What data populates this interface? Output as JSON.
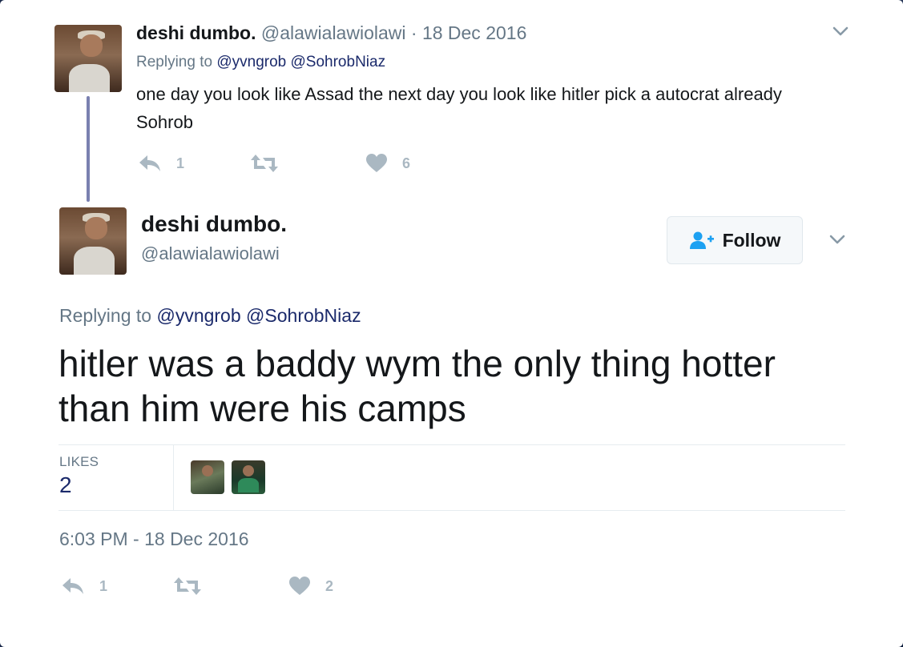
{
  "parent_tweet": {
    "name": "deshi dumbo.",
    "handle": "@alawialawiolawi",
    "separator": "·",
    "date": "18 Dec 2016",
    "replying_prefix": "Replying to",
    "mention1": "@yvngrob",
    "mention2": "@SohrobNiaz",
    "text": "one day you look like Assad the next day you look like hitler pick a autocrat already Sohrob",
    "reply_count": "1",
    "retweet_count": "",
    "like_count": "6"
  },
  "main_tweet": {
    "name": "deshi dumbo.",
    "handle": "@alawialawiolawi",
    "follow_label": "Follow",
    "replying_prefix": "Replying to",
    "mention1": "@yvngrob",
    "mention2": "@SohrobNiaz",
    "text": "hitler was a baddy wym the only thing hotter than him were his camps",
    "likes_label": "LIKES",
    "likes_count": "2",
    "timestamp": "6:03 PM - 18 Dec 2016",
    "reply_count": "1",
    "retweet_count": "",
    "like_count": "2"
  },
  "colors": {
    "text_primary": "#14171a",
    "text_secondary": "#657786",
    "mention": "#1b2a6b",
    "action_icon": "#aab8c2",
    "follow_icon": "#1da1f2",
    "thread_line": "#7a80b0"
  },
  "icons": {
    "reply": "reply-icon",
    "retweet": "retweet-icon",
    "like": "heart-icon",
    "follow": "add-user-icon",
    "caret": "chevron-down-icon"
  }
}
